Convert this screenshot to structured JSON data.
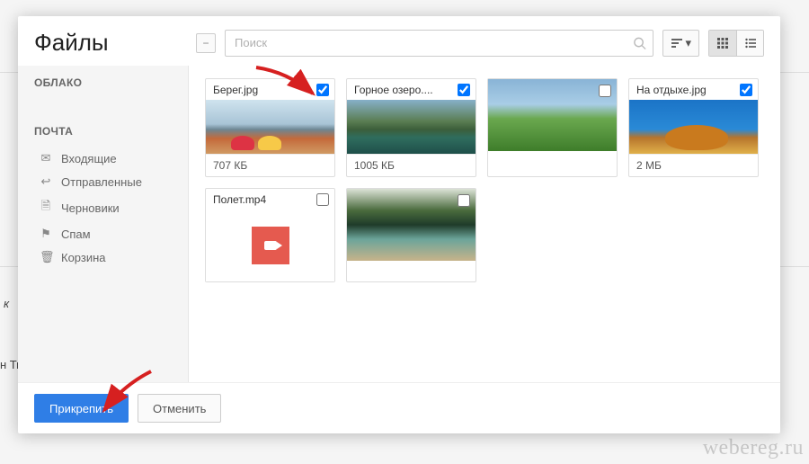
{
  "bg": {
    "italic_label": "к",
    "truncated": "н Ти",
    "watermark": "webereg.ru"
  },
  "header": {
    "title": "Файлы",
    "search_placeholder": "Поиск"
  },
  "sidebar": {
    "cloud_heading": "ОБЛАКО",
    "mail_heading": "ПОЧТА",
    "items": [
      {
        "icon": "✉",
        "label": "Входящие"
      },
      {
        "icon": "↩",
        "label": "Отправленные"
      },
      {
        "icon": "🗎",
        "label": "Черновики"
      },
      {
        "icon": "⚑",
        "label": "Спам"
      },
      {
        "icon": "🗑",
        "label": "Корзина"
      }
    ]
  },
  "files": [
    {
      "name": "Берег.jpg",
      "size": "707 КБ",
      "checked": true,
      "thumb": "th-beach",
      "has_size": true,
      "img_only": false
    },
    {
      "name": "Горное озеро....",
      "size": "1005 КБ",
      "checked": true,
      "thumb": "th-lake",
      "has_size": true,
      "img_only": false
    },
    {
      "name": "",
      "size": "",
      "checked": false,
      "thumb": "th-field",
      "has_size": false,
      "img_only": true
    },
    {
      "name": "На отдыхе.jpg",
      "size": "2 МБ",
      "checked": true,
      "thumb": "th-rest",
      "has_size": true,
      "img_only": false
    },
    {
      "name": "Полет.mp4",
      "size": "",
      "checked": false,
      "thumb": "th-video",
      "has_size": false,
      "img_only": false,
      "is_video": true
    },
    {
      "name": "",
      "size": "",
      "checked": false,
      "thumb": "th-forest",
      "has_size": false,
      "img_only": true
    }
  ],
  "footer": {
    "attach": "Прикрепить",
    "cancel": "Отменить"
  }
}
